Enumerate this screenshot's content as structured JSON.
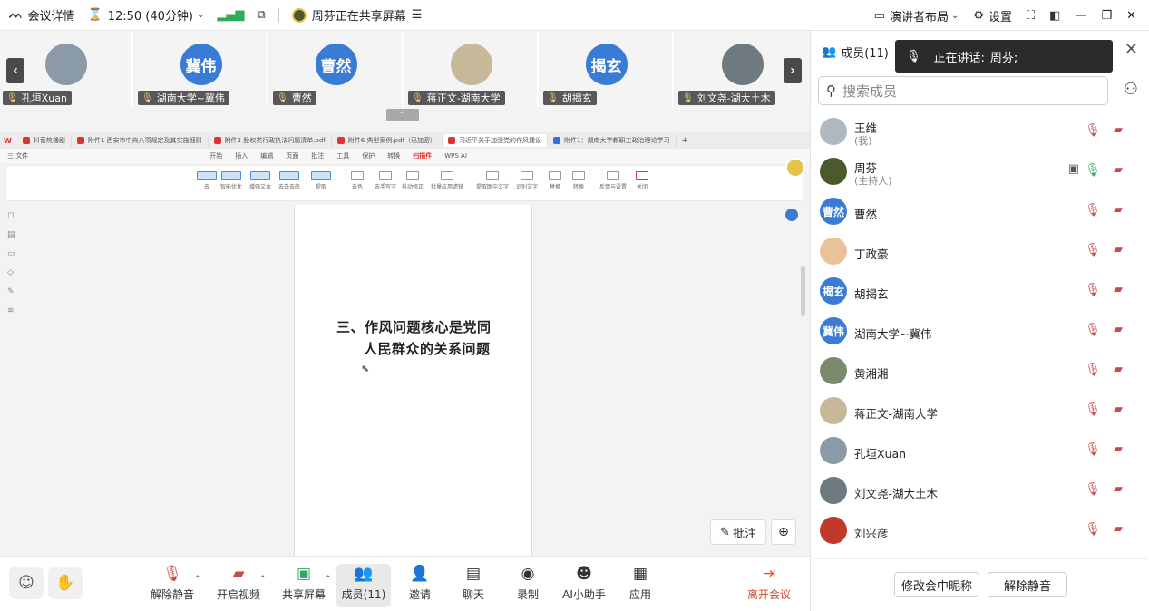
{
  "topbar": {
    "meeting_details": "会议详情",
    "time": "12:50 (40分钟)",
    "sharing_status": "周芬正在共享屏幕",
    "presenter_layout": "演讲者布局",
    "settings": "设置"
  },
  "strip": {
    "tiles": [
      {
        "avatar_text": "",
        "name": "孔垣Xuan",
        "color": "#8a9aa8"
      },
      {
        "avatar_text": "冀伟",
        "name": "湖南大学~冀伟",
        "color": "#3a7bd5"
      },
      {
        "avatar_text": "曹然",
        "name": "曹然",
        "color": "#3a7bd5"
      },
      {
        "avatar_text": "",
        "name": "蒋正文-湖南大学",
        "color": "#c8b89a"
      },
      {
        "avatar_text": "揭玄",
        "name": "胡揭玄",
        "color": "#3a7bd5"
      },
      {
        "avatar_text": "",
        "name": "刘文尧-湖大土木",
        "color": "#6f7a80"
      }
    ]
  },
  "wps": {
    "tabs": [
      "抖音热播剧",
      "附件1 西安市中央八项规定及其实施细则",
      "附件2 股权类行政执法问题清单.pdf",
      "附件6 典型案例.pdf（已加密）",
      "习近平关于加强党的作风建设",
      "附件1：湖南大学教职工政治理论学习"
    ],
    "menu": [
      "三 文件",
      "开始",
      "插入",
      "编辑",
      "页面",
      "批注",
      "工具",
      "保护",
      "转换",
      "扫描件",
      "WPS AI"
    ],
    "ribbon": [
      "去",
      "智能优化",
      "增强文本",
      "去白去底",
      "提取",
      "去色",
      "去手写字",
      "抖动修正",
      "批量应用滤镜",
      "提取图中文字",
      "识别文字",
      "替换",
      "转换",
      "反馈与设置",
      "关闭"
    ],
    "page_line1": "三、作风问题核心是党同",
    "page_line2": "人民群众的关系问题",
    "annotate": "批注"
  },
  "toolbar": {
    "unmute": "解除静音",
    "start_video": "开启视频",
    "share_screen": "共享屏幕",
    "members": "成员(11)",
    "invite": "邀请",
    "chat": "聊天",
    "record": "录制",
    "ai_assistant": "AI小助手",
    "apps": "应用",
    "leave": "离开会议"
  },
  "panel": {
    "title": "成员(11)",
    "speaking_label": "正在讲话:",
    "speaking_name": "周芬;",
    "search_placeholder": "搜索成员",
    "members": [
      {
        "name": "王维",
        "sub": "(我)",
        "avatar_text": "",
        "color": "#b0b8c0",
        "speaking": false
      },
      {
        "name": "周芬",
        "sub": "(主持人)",
        "avatar_text": "",
        "color": "#4a5a2a",
        "speaking": true
      },
      {
        "name": "曹然",
        "sub": "",
        "avatar_text": "曹然",
        "color": "#3a7bd5",
        "speaking": false
      },
      {
        "name": "丁政豪",
        "sub": "",
        "avatar_text": "",
        "color": "#e8c39a",
        "speaking": false
      },
      {
        "name": "胡揭玄",
        "sub": "",
        "avatar_text": "揭玄",
        "color": "#3a7bd5",
        "speaking": false
      },
      {
        "name": "湖南大学~冀伟",
        "sub": "",
        "avatar_text": "冀伟",
        "color": "#3a7bd5",
        "speaking": false
      },
      {
        "name": "黄湘湘",
        "sub": "",
        "avatar_text": "",
        "color": "#7a8a6a",
        "speaking": false
      },
      {
        "name": "蒋正文-湖南大学",
        "sub": "",
        "avatar_text": "",
        "color": "#c8b89a",
        "speaking": false
      },
      {
        "name": "孔垣Xuan",
        "sub": "",
        "avatar_text": "",
        "color": "#8a9aa8",
        "speaking": false
      },
      {
        "name": "刘文尧-湖大土木",
        "sub": "",
        "avatar_text": "",
        "color": "#6f7a80",
        "speaking": false
      },
      {
        "name": "刘兴彦",
        "sub": "",
        "avatar_text": "",
        "color": "#c0392b",
        "speaking": false
      }
    ],
    "rename_button": "修改会中昵称",
    "unmute_all_button": "解除静音"
  }
}
